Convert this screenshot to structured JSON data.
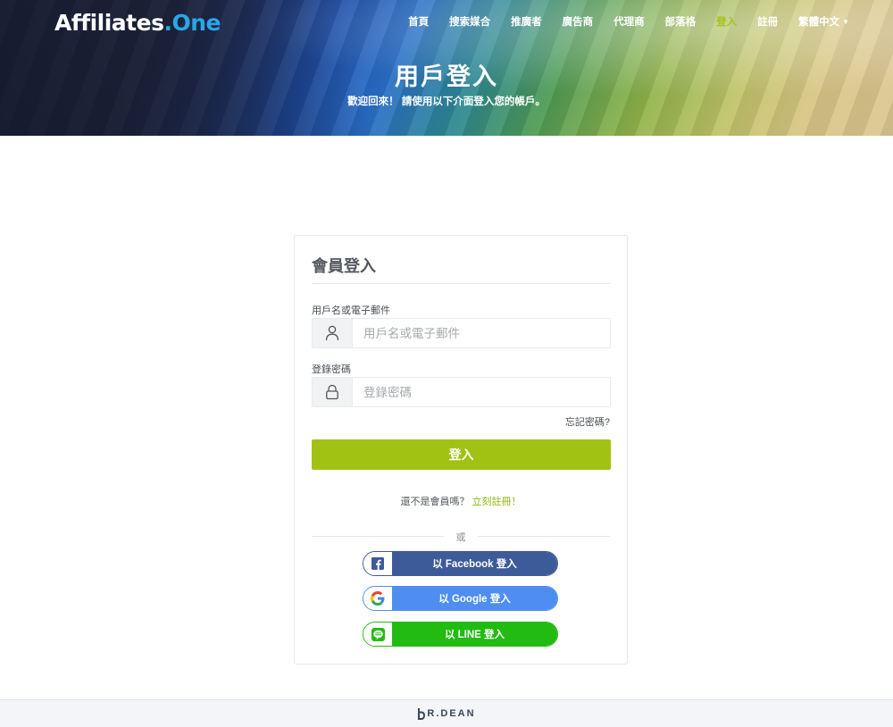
{
  "brand": {
    "logo_part1": "Affiliates",
    "logo_part2": ".One"
  },
  "nav": {
    "items": [
      "首頁",
      "搜索媒合",
      "推廣者",
      "廣告商",
      "代理商",
      "部落格",
      "登入",
      "註冊"
    ],
    "active_index": 6,
    "language": "繁體中文"
  },
  "hero": {
    "title": "用戶登入",
    "subtitle": "歡迎回來！ 請使用以下介面登入您的帳戶。"
  },
  "login": {
    "heading": "會員登入",
    "username_label": "用戶名或電子郵件",
    "username_placeholder": "用戶名或電子郵件",
    "password_label": "登錄密碼",
    "password_placeholder": "登錄密碼",
    "forgot": "忘記密碼?",
    "submit": "登入",
    "register_prompt": "還不是會員嗎？",
    "register_link": "立刻註冊！",
    "or": "或"
  },
  "social": {
    "facebook": "以 Facebook 登入",
    "google": "以 Google 登入",
    "line": "以 LINE 登入"
  },
  "footer": {
    "brand": "R.DEAN"
  },
  "colors": {
    "accent_green": "#a2c213",
    "facebook": "#3e5b99",
    "google": "#4d8ef0",
    "line": "#22bb11",
    "logo_blue": "#2aa6e8"
  }
}
